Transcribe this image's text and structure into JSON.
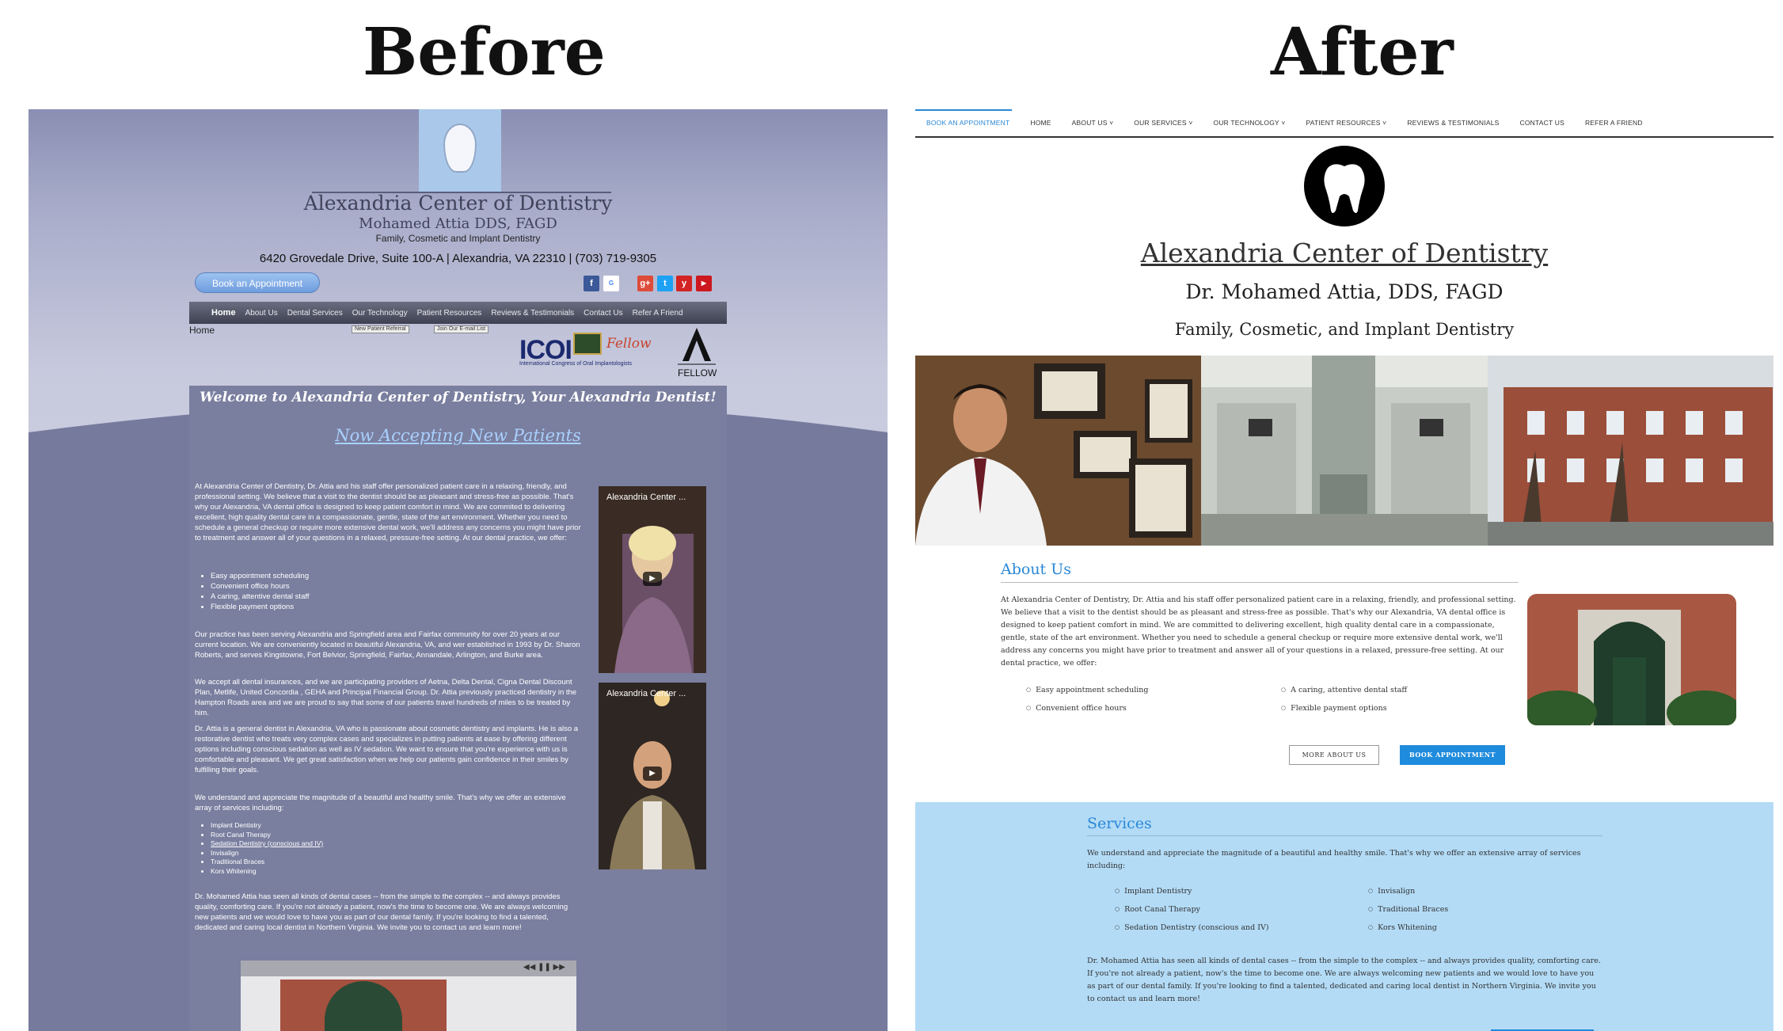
{
  "headings": {
    "before": "Before",
    "after": "After"
  },
  "before": {
    "title": "Alexandria Center of Dentistry",
    "doctor": "Mohamed Attia DDS, FAGD",
    "specialty": "Family, Cosmetic and Implant Dentistry",
    "address": "6420 Grovedale Drive, Suite 100-A  |  Alexandria, VA 22310  |  (703) 719-9305",
    "book_button": "Book an Appointment",
    "nav": [
      "Home",
      "About Us",
      "Dental Services",
      "Our Technology",
      "Patient Resources",
      "Reviews & Testimonials",
      "Contact Us",
      "Refer A Friend"
    ],
    "breadcrumb": "Home",
    "mini_buttons": [
      "New Patient Referral",
      "Join Our E-mail List"
    ],
    "icoi": "ICOI",
    "icoi_sub": "International Congress of Oral Implantologists",
    "fellow": "Fellow",
    "agd_fellow": "FELLOW",
    "welcome": "Welcome to Alexandria Center of Dentistry, Your Alexandria Dentist!",
    "accepting": "Now Accepting New Patients",
    "para1": "At Alexandria Center of Dentistry, Dr. Attia and his staff offer personalized patient care in a relaxing, friendly, and professional setting. We believe that a visit to the dentist should be as pleasant and stress-free as possible. That's why our Alexandria, VA dental office is designed to keep patient comfort in mind. We are commited to delivering excellent, high quality dental care in a compassionate, gentle, state of the art environment. Whether you need to schedule a general checkup or require more extensive dental work, we'll address any concerns you might have prior to treatment and answer all of your questions in a relaxed, pressure-free setting. At our dental practice, we offer:",
    "offers": [
      "Easy appointment scheduling",
      "Convenient office hours",
      "A caring, attentive dental staff",
      "Flexible payment options"
    ],
    "para2": "Our practice has been serving Alexandria and Springfield area and Fairfax community for over 20 years at our current location. We are conveniently located in beautiful Alexandria, VA, and wer established in 1993 by Dr. Sharon Roberts, and serves Kingstowne, Fort Belvior, Springfield, Fairfax, Annandale, Arlington, and Burke area.",
    "para3": "We accept all dental insurances, and we are participating providers of Aetna, Delta Dental, Cigna Dental Discount Plan, Metlife, United Concordia , GEHA and Principal Financial Group. Dr. Attia previously practiced dentistry in the Hampton Roads area and we are proud to say that some of our patients travel hundreds of miles to be treated by him.",
    "para4": "Dr. Attia is a general dentist in Alexandria, VA who is passionate about cosmetic dentistry and implants. He is also a restorative dentist who treats very complex cases and specializes in putting patients at ease by offering different options including conscious sedation as well as IV sedation. We want to ensure that you're experience with us is comfortable and pleasant. We get great satisfaction when we help our patients gain confidence in their smiles by fulfilling their goals.",
    "para5": "We understand and appreciate the magnitude of a beautiful and healthy smile. That's why we offer an extensive array of services including:",
    "services": [
      "Implant Dentistry",
      "Root Canal Therapy",
      "Sedation Dentistry (conscious and IV)",
      "Invisalign",
      "Traditional Braces",
      "Kors Whitening"
    ],
    "para6": "Dr. Mohamed Attia has seen all kinds of dental cases -- from the simple to the complex -- and always provides quality, comforting care. If you're not already a patient, now's the time to become one. We are always welcoming new patients and we would love to have you as part of our dental family. If you're looking to find a talented, dedicated and caring local dentist in Northern Virginia. We invite you to contact us and learn more!",
    "video_titles": [
      "Alexandria Center ...",
      "Alexandria Center ..."
    ],
    "colors": {
      "main": "#7a7f9f",
      "accent": "#a9d0ff"
    }
  },
  "after": {
    "nav": [
      "BOOK AN APPOINTMENT",
      "HOME",
      "ABOUT US ˅",
      "OUR SERVICES ˅",
      "OUR TECHNOLOGY ˅",
      "PATIENT RESOURCES ˅",
      "REVIEWS & TESTIMONIALS",
      "CONTACT US",
      "REFER A FRIEND"
    ],
    "title": "Alexandria Center of Dentistry",
    "doctor": "Dr. Mohamed Attia, DDS, FAGD",
    "specialty": "Family, Cosmetic, and Implant Dentistry",
    "about_heading": "About Us",
    "about_text": "At Alexandria Center of Dentistry, Dr. Attia and his staff offer personalized patient care in a relaxing, friendly, and professional setting. We believe that a visit to the dentist should be as pleasant and stress-free as possible. That's why our Alexandria, VA dental office is designed to keep patient comfort in mind. We are committed to delivering excellent, high quality dental care in a compassionate, gentle, state of the art environment. Whether you need to schedule a general checkup or require more extensive dental work, we'll address any concerns you might have prior to treatment and answer all of your questions in a relaxed, pressure-free setting. At our dental practice, we offer:",
    "offers": [
      "Easy appointment scheduling",
      "Convenient office hours",
      "A caring, attentive dental staff",
      "Flexible payment options"
    ],
    "more_button": "MORE ABOUT US",
    "book_button": "BOOK APPOINTMENT",
    "services_heading": "Services",
    "services_intro": "We understand and appreciate the magnitude of a beautiful and healthy smile. That's why we offer an extensive array of services including:",
    "services": [
      "Implant Dentistry",
      "Root Canal Therapy",
      "Sedation Dentistry (conscious and IV)",
      "Invisalign",
      "Traditional Braces",
      "Kors Whitening"
    ],
    "services_outro": "Dr. Mohamed Attia has seen all kinds of dental cases -- from the simple to the complex -- and always provides quality, comforting care. If you're not already a patient, now's the time to become one. We are always welcoming new patients and we would love to have you as part of our dental family. If you're looking to find a talented, dedicated and caring local dentist in Northern Virginia. We invite you to contact us and learn more!",
    "colors": {
      "accent": "#2a88d6",
      "services_bg": "#b3dbf6"
    }
  }
}
